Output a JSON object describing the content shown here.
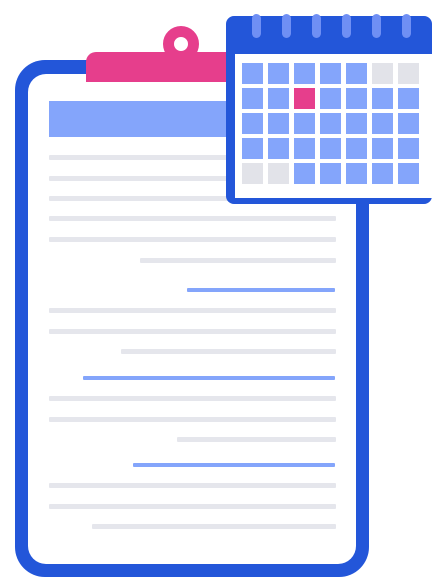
{
  "colors": {
    "frame_blue": "#2356d9",
    "accent_pink": "#e63e8c",
    "cell_blue": "#84a5fb",
    "cell_grey": "#e2e3e9",
    "line_grey": "#e5e6ec",
    "line_blue": "#84a5fb",
    "ring_blue": "#6f8ff4"
  },
  "clipboard": {
    "icon": "clipboard-icon",
    "line_colors": [
      "grey",
      "grey",
      "grey",
      "grey",
      "grey",
      "grey",
      "blue",
      "grey",
      "grey",
      "grey",
      "blue",
      "grey",
      "grey",
      "grey",
      "blue",
      "grey",
      "grey",
      "grey"
    ]
  },
  "calendar": {
    "icon": "calendar-icon",
    "cells": [
      "blue",
      "blue",
      "blue",
      "blue",
      "blue",
      "grey",
      "grey",
      "blue",
      "blue",
      "pink",
      "blue",
      "blue",
      "blue",
      "blue",
      "blue",
      "blue",
      "blue",
      "blue",
      "blue",
      "blue",
      "blue",
      "blue",
      "blue",
      "blue",
      "blue",
      "blue",
      "blue",
      "blue",
      "grey",
      "grey",
      "blue",
      "blue",
      "blue",
      "blue",
      "blue"
    ],
    "ring_count": 6
  }
}
